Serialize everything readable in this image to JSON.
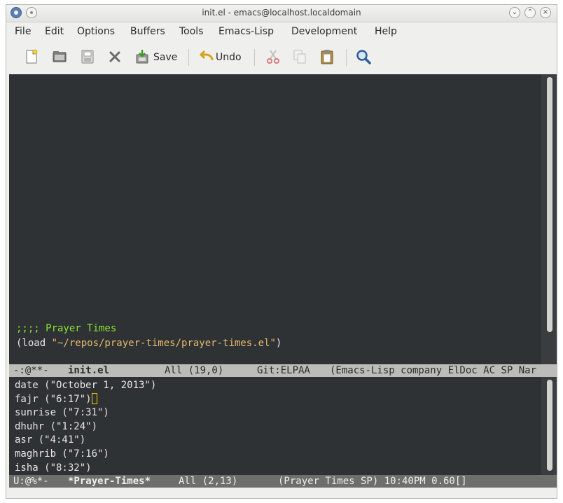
{
  "window": {
    "title": "init.el - emacs@localhost.localdomain"
  },
  "menu": {
    "items": [
      "File",
      "Edit",
      "Options",
      "Buffers",
      "Tools",
      "Emacs-Lisp",
      "Development",
      "Help"
    ]
  },
  "toolbar": {
    "save_label": "Save",
    "undo_label": "Undo",
    "icons": [
      "new-file-icon",
      "open-folder-icon",
      "save-disk-icon",
      "close-x-icon",
      "save-icon",
      "undo-icon",
      "cut-icon",
      "copy-icon",
      "paste-icon",
      "search-icon"
    ]
  },
  "editor": {
    "lines": [
      {
        "type": "comment",
        "text": ";;;; Prayer Times"
      },
      {
        "type": "code",
        "prefix": "(load ",
        "string": "\"~/repos/prayer-times/prayer-times.el\"",
        "suffix": ")"
      }
    ]
  },
  "modeline_top": {
    "status": "-:@**-",
    "buffer": "init.el",
    "position": "All (19,0)",
    "vc": "Git:ELPAA",
    "modes": "(Emacs-Lisp company ElDoc AC SP Nar"
  },
  "prayer_buffer": {
    "lines": [
      "date (\"October 1, 2013\")",
      "fajr (\"6:17\")",
      "sunrise (\"7:31\")",
      "dhuhr (\"1:24\")",
      "asr (\"4:41\")",
      "maghrib (\"7:16\")",
      "isha (\"8:32\")"
    ]
  },
  "modeline_bottom": {
    "status": "U:@%*-",
    "buffer": "*Prayer-Times*",
    "position": "All (2,13)",
    "modes": "(Prayer Times SP) 10:40PM 0.60[]"
  },
  "colors": {
    "editor_bg": "#2f3235",
    "comment": "#8ae234",
    "string": "#e9b96e",
    "text": "#e6e6e6",
    "cursor": "#f2d000"
  }
}
